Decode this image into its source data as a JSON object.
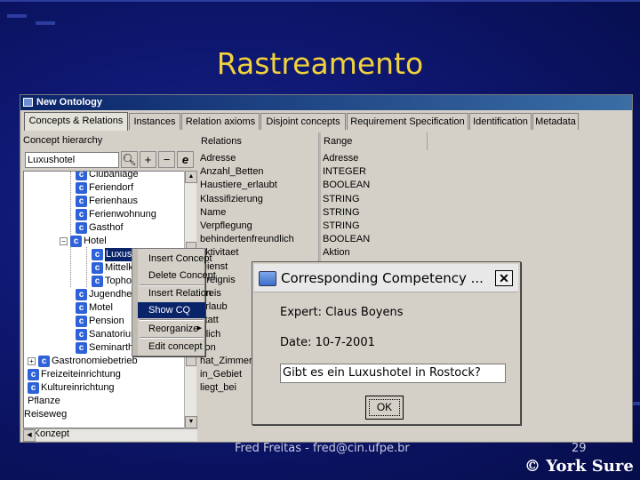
{
  "slide": {
    "title": "Rastreamento",
    "footer_author": "Fred Freitas - fred@cin.ufpe.br",
    "page_number": "29",
    "copyright": "© York Sure"
  },
  "window": {
    "title": "New Ontology",
    "tabs": [
      "Concepts & Relations",
      "Instances",
      "Relation axioms",
      "Disjoint concepts",
      "Requirement Specification",
      "Identification",
      "Metadata"
    ]
  },
  "left_panel": {
    "label": "Concept hierarchy",
    "search_value": "Luxushotel",
    "icons": [
      "search-icon",
      "plus-icon",
      "minus-icon",
      "edit-icon"
    ],
    "tree": [
      {
        "label": "Clubanlage",
        "expander": ""
      },
      {
        "label": "Feriendorf",
        "expander": ""
      },
      {
        "label": "Ferienhaus",
        "expander": ""
      },
      {
        "label": "Ferienwohnung",
        "expander": ""
      },
      {
        "label": "Gasthof",
        "expander": ""
      },
      {
        "label": "Hotel",
        "expander": "−"
      },
      {
        "label": "Luxushotel",
        "expander": ""
      },
      {
        "label": "Mittelklassehotel",
        "expander": ""
      },
      {
        "label": "Tophotel",
        "expander": ""
      },
      {
        "label": "Jugendherberge",
        "expander": ""
      },
      {
        "label": "Motel",
        "expander": ""
      },
      {
        "label": "Pension",
        "expander": ""
      },
      {
        "label": "Sanatorium",
        "expander": ""
      },
      {
        "label": "Seminarthotel",
        "expander": ""
      },
      {
        "label": "Gastronomiebetrieb",
        "expander": "+"
      },
      {
        "label": "Freizeiteinrichtung",
        "expander": ""
      },
      {
        "label": "Kultureinrichtung",
        "expander": ""
      },
      {
        "label": "Pflanze",
        "expander": ""
      },
      {
        "label": "Reiseweg",
        "expander": ""
      },
      {
        "label": "s. Konzept",
        "expander": ""
      }
    ]
  },
  "relations_table": {
    "headers": [
      "Relations",
      "Range"
    ],
    "rows": [
      [
        "Adresse",
        "Adresse"
      ],
      [
        "Anzahl_Betten",
        "INTEGER"
      ],
      [
        "Haustiere_erlaubt",
        "BOOLEAN"
      ],
      [
        "Klassifizierung",
        "STRING"
      ],
      [
        "Name",
        "STRING"
      ],
      [
        "Verpflegung",
        "STRING"
      ],
      [
        "behindertenfreundlich",
        "BOOLEAN"
      ],
      [
        "aktivitaet",
        "Aktion"
      ],
      [
        "Dienst",
        ""
      ],
      [
        "Ereignis",
        ""
      ],
      [
        "preis",
        ""
      ],
      [
        "urlaub",
        ""
      ],
      [
        "statt",
        ""
      ],
      [
        "rtlich",
        ""
      ],
      [
        "son",
        ""
      ],
      [
        "hat_Zimmer",
        ""
      ],
      [
        "in_Gebiet",
        ""
      ],
      [
        "liegt_bei",
        ""
      ]
    ]
  },
  "context_menu": {
    "items": [
      "Insert Concept",
      "Delete Concept",
      "Insert Relation",
      "Show CQ",
      "Reorganize",
      "Edit concept"
    ],
    "highlighted": "Show CQ"
  },
  "dialog": {
    "title": "Corresponding Competency ...",
    "close": "✕",
    "expert": "Expert: Claus Boyens",
    "date": "Date: 10-7-2001",
    "question": "Gibt es ein Luxushotel in Rostock?",
    "ok": "OK"
  }
}
